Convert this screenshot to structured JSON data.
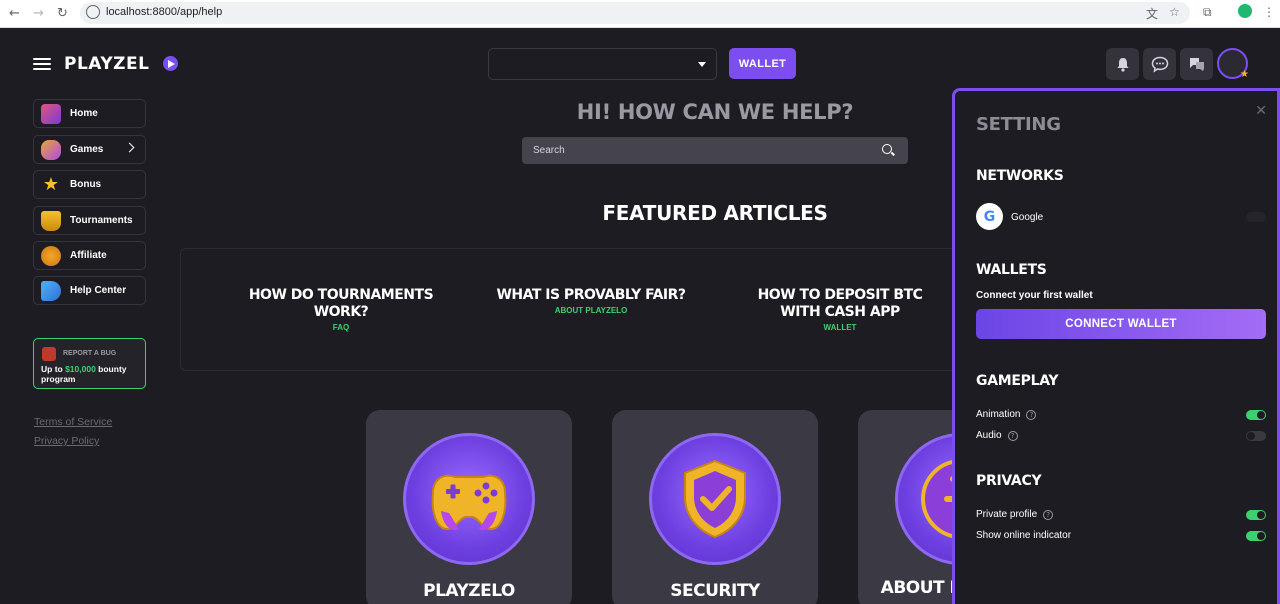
{
  "browser": {
    "url": "localhost:8800/app/help"
  },
  "header": {
    "logo_text": "PLAYZEL",
    "wallet_label": "WALLET",
    "currency_value": ""
  },
  "sidebar": {
    "items": [
      {
        "label": "Home",
        "icon": "castle-icon"
      },
      {
        "label": "Games",
        "icon": "gamepad-icon"
      },
      {
        "label": "Bonus",
        "icon": "star-icon"
      },
      {
        "label": "Tournaments",
        "icon": "trophy-icon"
      },
      {
        "label": "Affiliate",
        "icon": "coin-icon"
      },
      {
        "label": "Help Center",
        "icon": "megaphone-icon"
      }
    ],
    "bug_card": {
      "title": "REPORT A BUG",
      "text_before": "Up to ",
      "amount": "$10,000",
      "text_after": " bounty program"
    },
    "footer_links": [
      "Terms of Service",
      "Privacy Policy"
    ]
  },
  "main": {
    "title": "HI! HOW CAN WE HELP?",
    "search_placeholder": "Search",
    "featured_title": "FEATURED ARTICLES",
    "articles": [
      {
        "title": "HOW DO TOURNAMENTS WORK?",
        "category": "FAQ"
      },
      {
        "title": "WHAT IS PROVABLY FAIR?",
        "category": "ABOUT PLAYZELO"
      },
      {
        "title": "HOW TO DEPOSIT BTC WITH CASH APP",
        "category": "WALLET"
      }
    ],
    "cards": [
      {
        "title": "PLAYZELO",
        "icon": "gamepad-icon"
      },
      {
        "title": "SECURITY",
        "icon": "shield-icon"
      },
      {
        "title": "ABOUT PLAYZELO",
        "icon": "coin-icon"
      }
    ]
  },
  "settings": {
    "title": "SETTING",
    "networks_title": "NETWORKS",
    "google_label": "Google",
    "wallets_title": "WALLETS",
    "wallets_subtitle": "Connect your first wallet",
    "connect_label": "CONNECT WALLET",
    "gameplay_title": "GAMEPLAY",
    "animation_label": "Animation",
    "audio_label": "Audio",
    "privacy_title": "PRIVACY",
    "private_profile_label": "Private profile",
    "online_indicator_label": "Show online indicator",
    "animation_on": true,
    "audio_on": false,
    "private_profile_on": true,
    "online_indicator_on": true
  },
  "colors": {
    "accent": "#7c4ef0",
    "success": "#3bd16f",
    "background": "#1d1c22"
  }
}
